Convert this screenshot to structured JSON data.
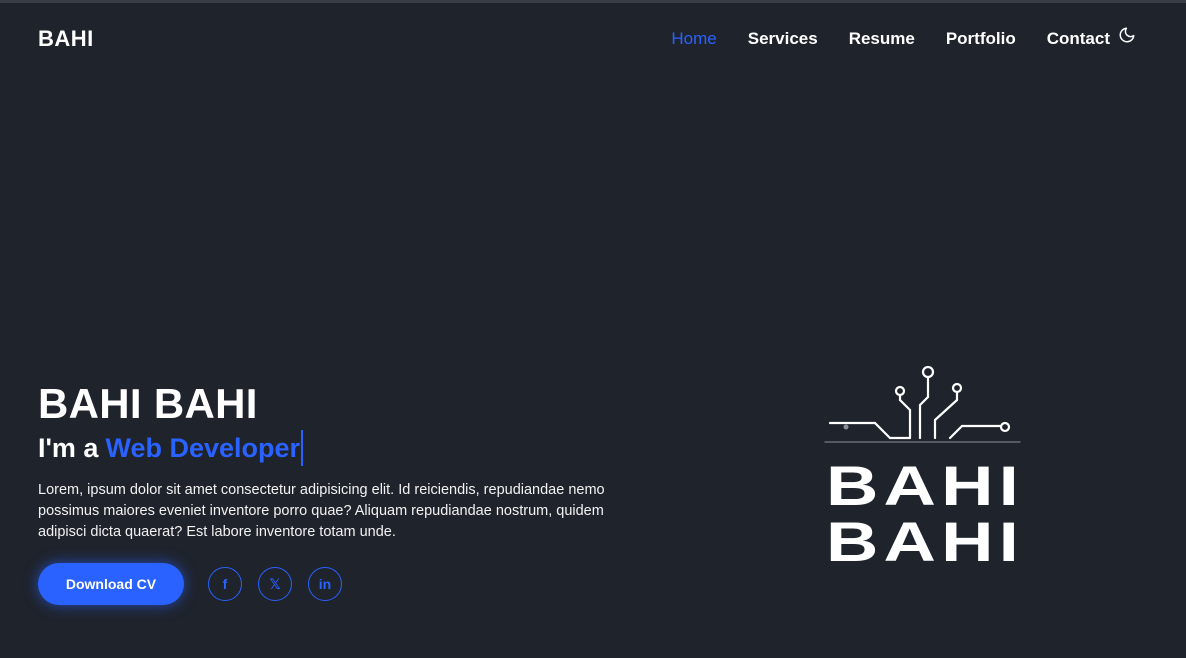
{
  "header": {
    "logo": "BAHI",
    "nav": [
      {
        "label": "Home",
        "active": true
      },
      {
        "label": "Services"
      },
      {
        "label": "Resume"
      },
      {
        "label": "Portfolio"
      },
      {
        "label": "Contact"
      }
    ],
    "theme_toggle_icon": "moon-icon"
  },
  "hero": {
    "name": "BAHI BAHI",
    "role_prefix": "I'm a",
    "role_highlight": "Web Developer",
    "description": "Lorem, ipsum dolor sit amet consectetur adipisicing elit. Id reiciendis, repudiandae nemo possimus maiores eveniet inventore porro quae? Aliquam repudiandae nostrum, quidem adipisci dicta quaerat? Est labore inventore totam unde.",
    "cv_button": "Download CV",
    "socials": [
      {
        "icon": "facebook-icon",
        "glyph": "f"
      },
      {
        "icon": "x-icon",
        "glyph": "𝕏"
      },
      {
        "icon": "linkedin-icon",
        "glyph": "in"
      }
    ]
  },
  "brand_logo": {
    "line1": "BAHI",
    "line2": "BAHI"
  },
  "colors": {
    "background": "#1f232c",
    "accent": "#2962ff",
    "text": "#ffffff"
  }
}
